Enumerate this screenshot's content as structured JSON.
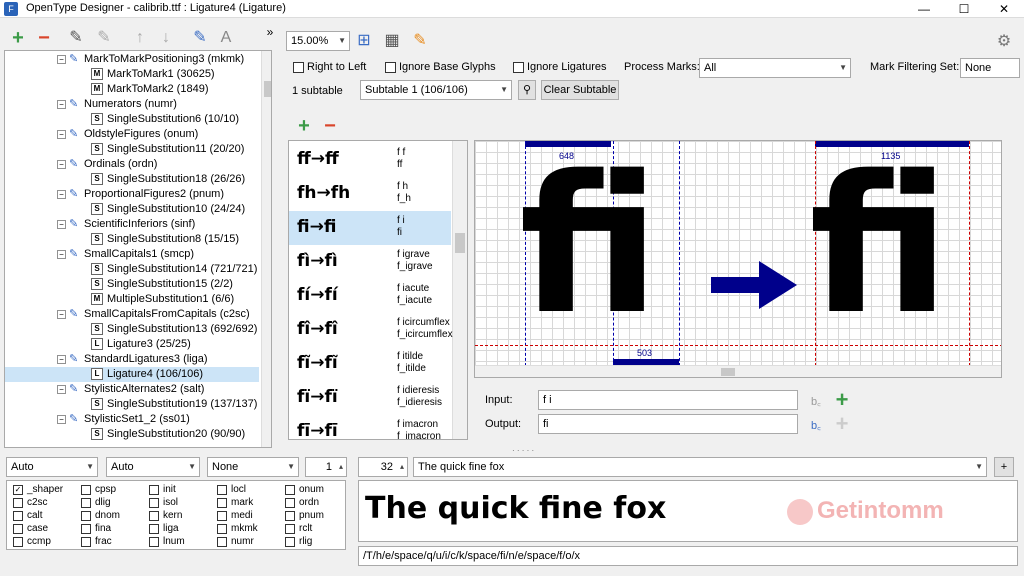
{
  "window": {
    "title": "OpenType Designer - calibrib.ttf : Ligature4 (Ligature)",
    "minimize": "—",
    "maximize": "☐",
    "close": "✕"
  },
  "toolbar": {
    "zoom": "15.00%"
  },
  "options": {
    "right_to_left": "Right to Left",
    "ignore_base": "Ignore Base Glyphs",
    "ignore_lig": "Ignore Ligatures",
    "process_marks_label": "Process Marks:",
    "process_marks_value": "All",
    "mark_filter_label": "Mark Filtering Set:",
    "mark_filter_value": "None",
    "subtable_count": "1 subtable",
    "subtable_value": "Subtable 1 (106/106)",
    "clear_subtable": "Clear Subtable"
  },
  "tree": [
    {
      "kind": "lookup",
      "label": "MarkToMarkPositioning3 (mkmk)"
    },
    {
      "kind": "sub",
      "icon": "M",
      "label": "MarkToMark1 (30625)"
    },
    {
      "kind": "sub",
      "icon": "M",
      "label": "MarkToMark2 (1849)"
    },
    {
      "kind": "lookup",
      "label": "Numerators (numr)"
    },
    {
      "kind": "sub",
      "icon": "S",
      "label": "SingleSubstitution6 (10/10)"
    },
    {
      "kind": "lookup",
      "label": "OldstyleFigures (onum)"
    },
    {
      "kind": "sub",
      "icon": "S",
      "label": "SingleSubstitution11 (20/20)"
    },
    {
      "kind": "lookup",
      "label": "Ordinals (ordn)"
    },
    {
      "kind": "sub",
      "icon": "S",
      "label": "SingleSubstitution18 (26/26)"
    },
    {
      "kind": "lookup",
      "label": "ProportionalFigures2 (pnum)"
    },
    {
      "kind": "sub",
      "icon": "S",
      "label": "SingleSubstitution10 (24/24)"
    },
    {
      "kind": "lookup",
      "label": "ScientificInferiors (sinf)"
    },
    {
      "kind": "sub",
      "icon": "S",
      "label": "SingleSubstitution8 (15/15)"
    },
    {
      "kind": "lookup",
      "label": "SmallCapitals1 (smcp)"
    },
    {
      "kind": "sub",
      "icon": "S",
      "label": "SingleSubstitution14 (721/721)"
    },
    {
      "kind": "sub",
      "icon": "S",
      "label": "SingleSubstitution15 (2/2)"
    },
    {
      "kind": "sub",
      "icon": "M",
      "label": "MultipleSubstitution1 (6/6)"
    },
    {
      "kind": "lookup",
      "label": "SmallCapitalsFromCapitals (c2sc)"
    },
    {
      "kind": "sub",
      "icon": "S",
      "label": "SingleSubstitution13 (692/692)"
    },
    {
      "kind": "sub",
      "icon": "L",
      "label": "Ligature3 (25/25)"
    },
    {
      "kind": "lookup",
      "label": "StandardLigatures3 (liga)"
    },
    {
      "kind": "sub",
      "icon": "L",
      "label": "Ligature4 (106/106)",
      "selected": true
    },
    {
      "kind": "lookup",
      "label": "StylisticAlternates2 (salt)"
    },
    {
      "kind": "sub",
      "icon": "S",
      "label": "SingleSubstitution19 (137/137)"
    },
    {
      "kind": "lookup",
      "label": "StylisticSet1_2 (ss01)"
    },
    {
      "kind": "sub",
      "icon": "S",
      "label": "SingleSubstitution20 (90/90)"
    }
  ],
  "ligatures": [
    {
      "display": "ff→ff",
      "input": "f f",
      "output": "ff"
    },
    {
      "display": "fh→fh",
      "input": "f h",
      "output": "f_h"
    },
    {
      "display": "fi→fi",
      "input": "f i",
      "output": "fi",
      "selected": true
    },
    {
      "display": "fì→fì",
      "input": "f igrave",
      "output": "f_igrave"
    },
    {
      "display": "fí→fí",
      "input": "f iacute",
      "output": "f_iacute"
    },
    {
      "display": "fî→fî",
      "input": "f icircumflex",
      "output": "f_icircumflex"
    },
    {
      "display": "fĩ→fĩ",
      "input": "f itilde",
      "output": "f_itilde"
    },
    {
      "display": "fï→fï",
      "input": "f idieresis",
      "output": "f_idieresis"
    },
    {
      "display": "fī→fī",
      "input": "f imacron",
      "output": "f_imacron"
    }
  ],
  "canvas": {
    "input_glyphs": "fi",
    "output_glyph": "fi",
    "width_left": "648",
    "width_mid": "503",
    "width_right": "1135"
  },
  "io": {
    "input_label": "Input:",
    "input_value": "f i",
    "output_label": "Output:",
    "output_value": "fi"
  },
  "bottom": {
    "script": "Auto",
    "language": "Auto",
    "direction": "None",
    "spin": "1",
    "size": "32",
    "sample_text": "The quick fine fox",
    "preview_text": "The quick fine fox",
    "glyph_path": "/T/h/e/space/q/u/i/c/k/space/fi/n/e/space/f/o/x",
    "watermark": "Getintomm"
  },
  "features": [
    {
      "tag": "_shaper",
      "checked": true
    },
    {
      "tag": "cpsp"
    },
    {
      "tag": "init"
    },
    {
      "tag": "locl"
    },
    {
      "tag": "onum"
    },
    {
      "tag": "c2sc"
    },
    {
      "tag": "dlig"
    },
    {
      "tag": "isol"
    },
    {
      "tag": "mark"
    },
    {
      "tag": "ordn"
    },
    {
      "tag": "calt"
    },
    {
      "tag": "dnom"
    },
    {
      "tag": "kern"
    },
    {
      "tag": "medi"
    },
    {
      "tag": "pnum"
    },
    {
      "tag": "case"
    },
    {
      "tag": "fina"
    },
    {
      "tag": "liga"
    },
    {
      "tag": "mkmk"
    },
    {
      "tag": "rclt"
    },
    {
      "tag": "ccmp"
    },
    {
      "tag": "frac"
    },
    {
      "tag": "lnum"
    },
    {
      "tag": "numr"
    },
    {
      "tag": "rlig"
    }
  ],
  "colors": {
    "accent": "#00008b",
    "plus_green": "#3c9b48",
    "minus_red": "#d9452b",
    "selection": "#cce4f7"
  }
}
